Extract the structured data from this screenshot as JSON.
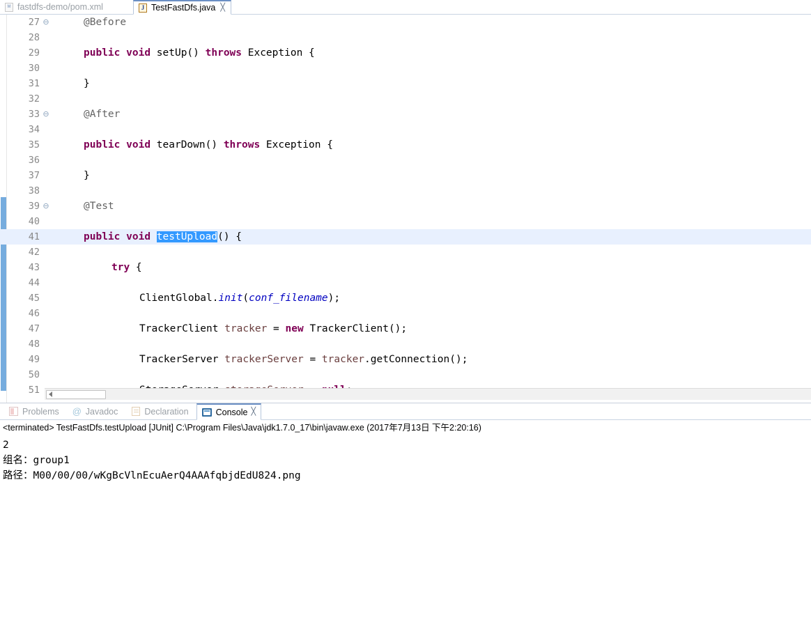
{
  "editor_tabs": [
    {
      "label": "fastdfs-demo/pom.xml",
      "icon": "xml-file-icon",
      "active": false,
      "closable": false
    },
    {
      "label": "TestFastDfs.java",
      "icon": "java-file-icon",
      "active": true,
      "closable": true,
      "close_glyph": "╳"
    }
  ],
  "editor": {
    "font_note": "",
    "highlight_line": 41,
    "selection_text": "testUpload",
    "selection_color": "#3399ff",
    "current_line_color": "#e8f0fe",
    "lines": [
      {
        "no": "27",
        "fold": "⊖",
        "indent": 1,
        "text": "@Before"
      },
      {
        "no": "28",
        "fold": "",
        "indent": 0,
        "text": ""
      },
      {
        "no": "29",
        "fold": "",
        "indent": 1,
        "text": "public void setUp() throws Exception {"
      },
      {
        "no": "30",
        "fold": "",
        "indent": 0,
        "text": ""
      },
      {
        "no": "31",
        "fold": "",
        "indent": 1,
        "text": "}"
      },
      {
        "no": "32",
        "fold": "",
        "indent": 0,
        "text": ""
      },
      {
        "no": "33",
        "fold": "⊖",
        "indent": 1,
        "text": "@After"
      },
      {
        "no": "34",
        "fold": "",
        "indent": 0,
        "text": ""
      },
      {
        "no": "35",
        "fold": "",
        "indent": 1,
        "text": "public void tearDown() throws Exception {"
      },
      {
        "no": "36",
        "fold": "",
        "indent": 0,
        "text": ""
      },
      {
        "no": "37",
        "fold": "",
        "indent": 1,
        "text": "}"
      },
      {
        "no": "38",
        "fold": "",
        "indent": 0,
        "text": ""
      },
      {
        "no": "39",
        "fold": "⊖",
        "indent": 1,
        "text": "@Test"
      },
      {
        "no": "40",
        "fold": "",
        "indent": 0,
        "text": ""
      },
      {
        "no": "41",
        "fold": "",
        "indent": 1,
        "text": "public void testUpload() {"
      },
      {
        "no": "42",
        "fold": "",
        "indent": 0,
        "text": ""
      },
      {
        "no": "43",
        "fold": "",
        "indent": 2,
        "text": "try {"
      },
      {
        "no": "44",
        "fold": "",
        "indent": 0,
        "text": ""
      },
      {
        "no": "45",
        "fold": "",
        "indent": 3,
        "text": "ClientGlobal.init(conf_filename);"
      },
      {
        "no": "46",
        "fold": "",
        "indent": 0,
        "text": ""
      },
      {
        "no": "47",
        "fold": "",
        "indent": 3,
        "text": "TrackerClient tracker = new TrackerClient();"
      },
      {
        "no": "48",
        "fold": "",
        "indent": 0,
        "text": ""
      },
      {
        "no": "49",
        "fold": "",
        "indent": 3,
        "text": "TrackerServer trackerServer = tracker.getConnection();"
      },
      {
        "no": "50",
        "fold": "",
        "indent": 0,
        "text": ""
      },
      {
        "no": "51",
        "fold": "",
        "indent": 3,
        "text": "StorageServer storageServer = null;"
      }
    ]
  },
  "view_tabs": [
    {
      "label": "Problems",
      "icon": "problems-icon",
      "active": false
    },
    {
      "label": "Javadoc",
      "icon": "javadoc-at-icon",
      "active": false
    },
    {
      "label": "Declaration",
      "icon": "declaration-icon",
      "active": false
    },
    {
      "label": "Console",
      "icon": "console-icon",
      "active": true,
      "close_glyph": "╳"
    }
  ],
  "console": {
    "header": "<terminated> TestFastDfs.testUpload [JUnit] C:\\Program Files\\Java\\jdk1.7.0_17\\bin\\javaw.exe (2017年7月13日 下午2:20:16)",
    "output_lines": [
      "2",
      "组名：group1",
      "路径：M00/00/00/wKgBcVlnEcuAerQ4AAAfqbjdEdU824.png"
    ]
  },
  "scrollbar": {
    "horizontal_thumb_label": "",
    "arrow_glyph": ""
  }
}
